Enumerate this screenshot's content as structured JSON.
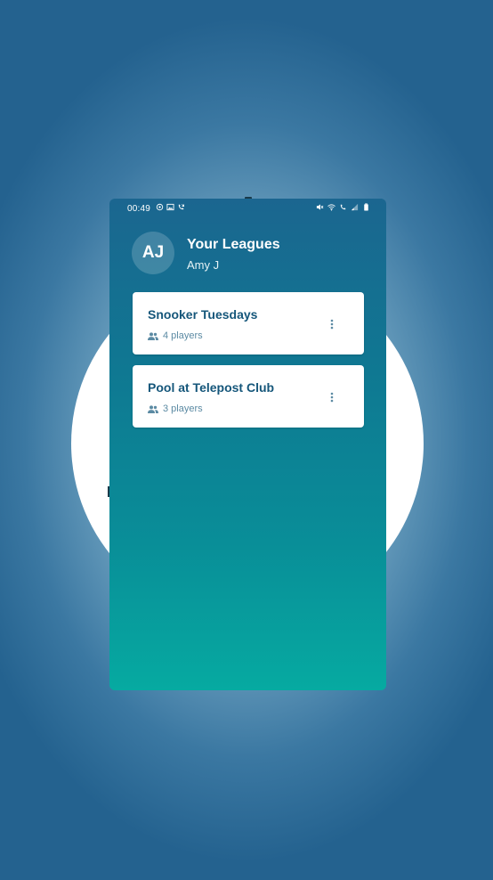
{
  "status_bar": {
    "time": "00:49",
    "left_icons": [
      "hotspot-icon",
      "gallery-icon",
      "missed-call-icon"
    ],
    "right_icons": [
      "mute-icon",
      "wifi-icon",
      "call-icon",
      "signal-icon",
      "battery-icon"
    ]
  },
  "header": {
    "avatar_initials": "AJ",
    "title": "Your Leagues",
    "user_name": "Amy J"
  },
  "leagues": [
    {
      "name": "Snooker Tuesdays",
      "players": "4 players",
      "icon": "group-icon",
      "menu_icon": "more-vert-icon"
    },
    {
      "name": "Pool at Telepost Club",
      "players": "3 players",
      "icon": "group-icon",
      "menu_icon": "more-vert-icon"
    }
  ],
  "colors": {
    "card_title": "#15567a",
    "card_meta": "#5b8aa3",
    "gradient_top": "#1b6690",
    "gradient_bottom": "#06aaa1"
  }
}
